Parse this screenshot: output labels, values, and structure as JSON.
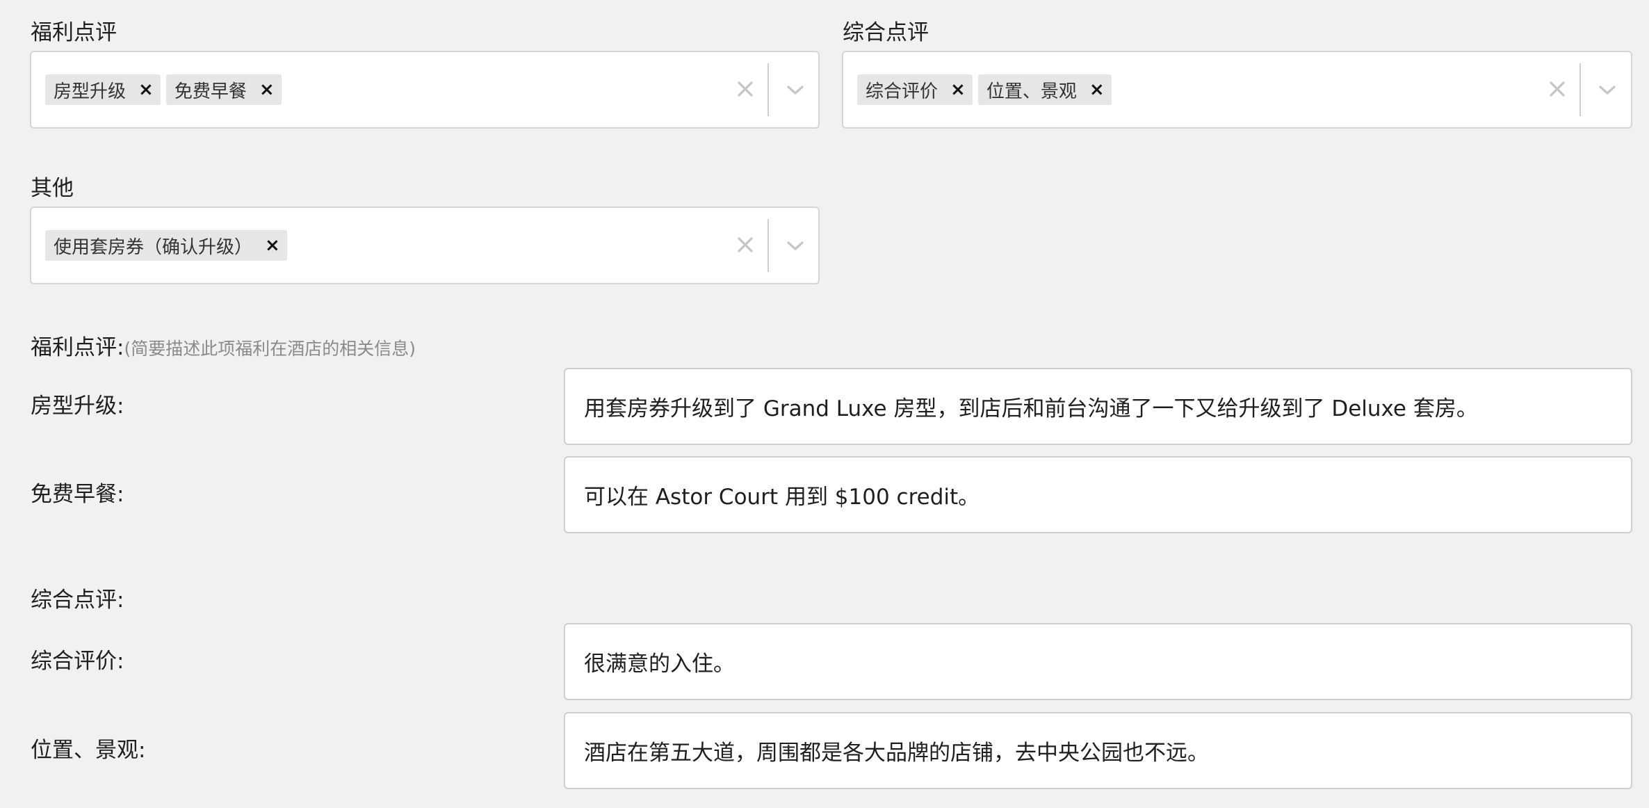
{
  "benefit_select": {
    "label": "福利点评",
    "chips": [
      "房型升级",
      "免费早餐"
    ],
    "chip_remove": "×"
  },
  "overall_select": {
    "label": "综合点评",
    "chips": [
      "综合评价",
      "位置、景观"
    ],
    "chip_remove": "×"
  },
  "other_select": {
    "label": "其他",
    "chips": [
      "使用套房券（确认升级）"
    ],
    "chip_remove": "×"
  },
  "benefit_review": {
    "heading": "福利点评:",
    "hint": "(简要描述此项福利在酒店的相关信息)",
    "items": [
      {
        "label": "房型升级:",
        "value": "用套房券升级到了 Grand Luxe 房型，到店后和前台沟通了一下又给升级到了 Deluxe 套房。"
      },
      {
        "label": "免费早餐:",
        "value": "可以在 Astor Court 用到 $100 credit。"
      }
    ]
  },
  "overall_review": {
    "heading": "综合点评:",
    "items": [
      {
        "label": "综合评价:",
        "value": "很满意的入住。"
      },
      {
        "label": "位置、景观:",
        "value": "酒店在第五大道，周围都是各大品牌的店铺，去中央公园也不远。"
      }
    ]
  },
  "icons": {
    "clear": "close-icon",
    "dropdown": "chevron-down-icon"
  },
  "colors": {
    "background": "#f1f1f1",
    "chip_bg": "#e6e6e6",
    "border": "#d5d5d5",
    "hint": "#8a8a8a"
  }
}
